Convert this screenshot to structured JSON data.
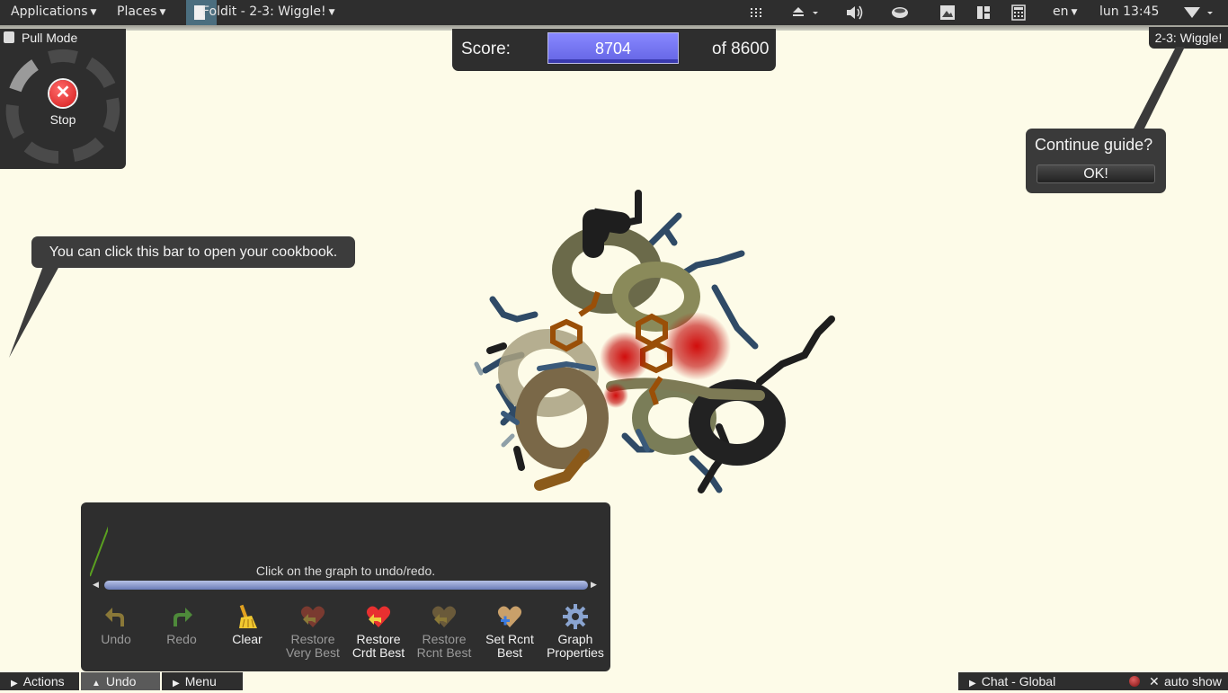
{
  "topbar": {
    "applications": "Applications",
    "places": "Places",
    "window_title": "Foldit - 2-3: Wiggle!",
    "language": "en",
    "clock": "lun 13:45",
    "icons": [
      "grid-icon",
      "eject-icon",
      "volume-icon",
      "coffee-icon",
      "image-icon",
      "layout-icon",
      "calculator-icon",
      "wifi-icon"
    ]
  },
  "score": {
    "label": "Score:",
    "value": "8704",
    "target": "of 8600",
    "color": "#7474f4"
  },
  "pull_mode": {
    "title": "Pull Mode",
    "stop_label": "Stop",
    "stop_color": "#d41a1a"
  },
  "guide": {
    "tag": "2-3: Wiggle!",
    "question": "Continue guide?",
    "ok": "OK!"
  },
  "cookbook_hint": "You can click this bar to open your cookbook.",
  "undo_panel": {
    "hint": "Click on the graph to undo/redo.",
    "tools": [
      {
        "line1": "Undo",
        "line2": "",
        "icon": "undo-arrow-icon",
        "enabled": false
      },
      {
        "line1": "Redo",
        "line2": "",
        "icon": "redo-arrow-icon",
        "enabled": false
      },
      {
        "line1": "Clear",
        "line2": "",
        "icon": "broom-icon",
        "enabled": true
      },
      {
        "line1": "Restore",
        "line2": "Very Best",
        "icon": "heart-restore-icon",
        "enabled": false
      },
      {
        "line1": "Restore",
        "line2": "Crdt Best",
        "icon": "heart-restore-icon",
        "enabled": true
      },
      {
        "line1": "Restore",
        "line2": "Rcnt Best",
        "icon": "heart-restore-icon",
        "enabled": false
      },
      {
        "line1": "Set Rcnt",
        "line2": "Best",
        "icon": "heart-plus-icon",
        "enabled": true
      },
      {
        "line1": "Graph",
        "line2": "Properties",
        "icon": "gear-icon",
        "enabled": true
      }
    ]
  },
  "bottom_tabs": {
    "actions": "Actions",
    "undo": "Undo",
    "menu": "Menu",
    "chat": "Chat - Global",
    "auto_show": "auto show"
  }
}
